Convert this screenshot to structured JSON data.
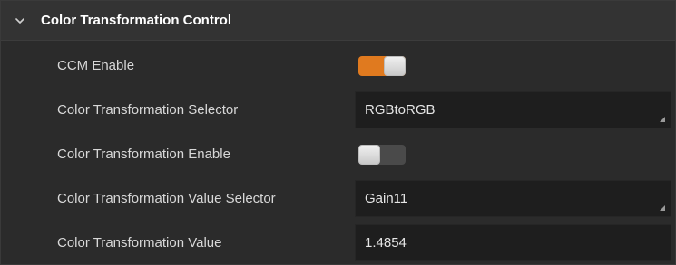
{
  "section": {
    "title": "Color Transformation Control",
    "expanded": true,
    "chevron_icon": "chevron-down-icon"
  },
  "rows": [
    {
      "label": "CCM Enable",
      "type": "toggle",
      "value": true
    },
    {
      "label": "Color Transformation Selector",
      "type": "dropdown",
      "value": "RGBtoRGB"
    },
    {
      "label": "Color Transformation Enable",
      "type": "toggle",
      "value": false
    },
    {
      "label": "Color Transformation Value Selector",
      "type": "dropdown",
      "value": "Gain11"
    },
    {
      "label": "Color Transformation Value",
      "type": "field",
      "value": "1.4854"
    }
  ],
  "colors": {
    "background": "#2b2b2b",
    "header_background": "#333333",
    "field_background": "#1e1e1e",
    "toggle_on": "#e07a1f",
    "toggle_off": "#4a4a4a",
    "label_text": "#d8d8d8",
    "title_text": "#ffffff"
  }
}
